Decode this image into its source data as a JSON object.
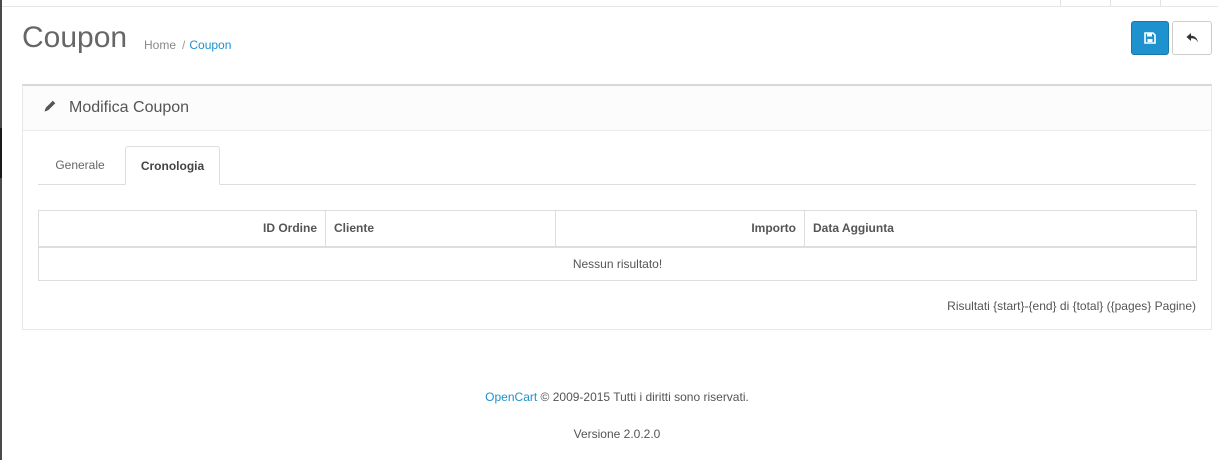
{
  "page": {
    "title": "Coupon",
    "breadcrumb": {
      "home": "Home",
      "separator": "/",
      "current": "Coupon"
    }
  },
  "toolbar": {
    "save_icon": "floppy-disk-icon",
    "back_icon": "reply-arrow-icon",
    "save_color": "#1e91cf"
  },
  "panel": {
    "icon": "pencil-icon",
    "title": "Modifica Coupon"
  },
  "tabs": [
    {
      "label": "Generale",
      "active": false
    },
    {
      "label": "Cronologia",
      "active": true
    }
  ],
  "history": {
    "columns": [
      "ID Ordine",
      "Cliente",
      "Importo",
      "Data Aggiunta"
    ],
    "empty_message": "Nessun risultato!",
    "results_text": "Risultati {start}-{end} di {total} ({pages} Pagine)"
  },
  "footer": {
    "brand_link": "OpenCart",
    "copyright": "© 2009-2015 Tutti i diritti sono riservati.",
    "version": "Versione 2.0.2.0"
  }
}
